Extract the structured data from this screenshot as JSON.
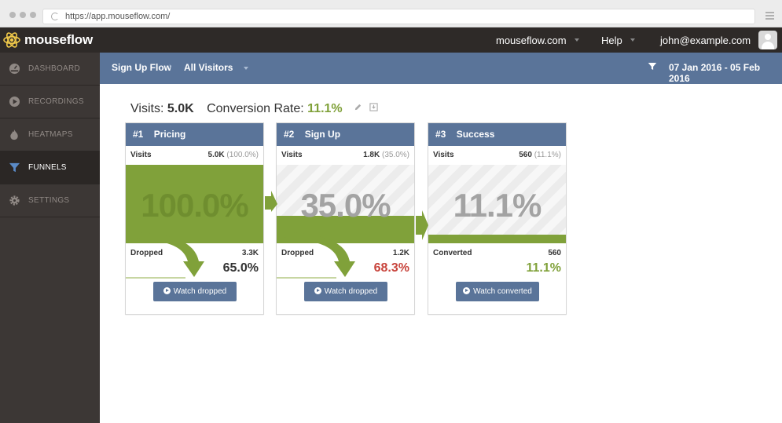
{
  "browser": {
    "url": "https://app.mouseflow.com/"
  },
  "app": {
    "logo_text": "mouseflow"
  },
  "topnav": {
    "site": "mouseflow.com",
    "help": "Help",
    "user": "john@example.com"
  },
  "sidebar": {
    "items": [
      {
        "label": "DASHBOARD",
        "icon": "dashboard-icon",
        "active": false
      },
      {
        "label": "RECORDINGS",
        "icon": "play-circle-icon",
        "active": false
      },
      {
        "label": "HEATMAPS",
        "icon": "flame-icon",
        "active": false
      },
      {
        "label": "FUNNELS",
        "icon": "funnel-icon",
        "active": true
      },
      {
        "label": "SETTINGS",
        "icon": "gear-icon",
        "active": false
      }
    ]
  },
  "subheader": {
    "funnel_name": "Sign Up Flow",
    "segment": "All Visitors",
    "date_range": "07 Jan 2016 - 05 Feb 2016"
  },
  "summary": {
    "visits_label": "Visits:",
    "visits_value": "5.0K",
    "conversion_label": "Conversion Rate:",
    "conversion_value": "11.1%"
  },
  "steps": [
    {
      "step": "#1",
      "name": "Pricing",
      "visits_label": "Visits",
      "visits": "5.0K",
      "visits_pct": "(100.0%)",
      "big_pct": "100.0%",
      "fill": 1.0,
      "out_label": "Dropped",
      "out_count": "3.3K",
      "out_pct": "65.0%",
      "button": "Watch dropped"
    },
    {
      "step": "#2",
      "name": "Sign Up",
      "visits_label": "Visits",
      "visits": "1.8K",
      "visits_pct": "(35.0%)",
      "big_pct": "35.0%",
      "fill": 0.35,
      "out_label": "Dropped",
      "out_count": "1.2K",
      "out_pct": "68.3%",
      "button": "Watch dropped"
    },
    {
      "step": "#3",
      "name": "Success",
      "visits_label": "Visits",
      "visits": "560",
      "visits_pct": "(11.1%)",
      "big_pct": "11.1%",
      "fill": 0.111,
      "out_label": "Converted",
      "out_count": "560",
      "out_pct": "11.1%",
      "button": "Watch converted"
    }
  ],
  "colors": {
    "accent": "#5a7499",
    "success": "#80a13a",
    "danger": "#c8443c",
    "sidebar": "#3c3735",
    "topbar": "#2e2a28"
  }
}
